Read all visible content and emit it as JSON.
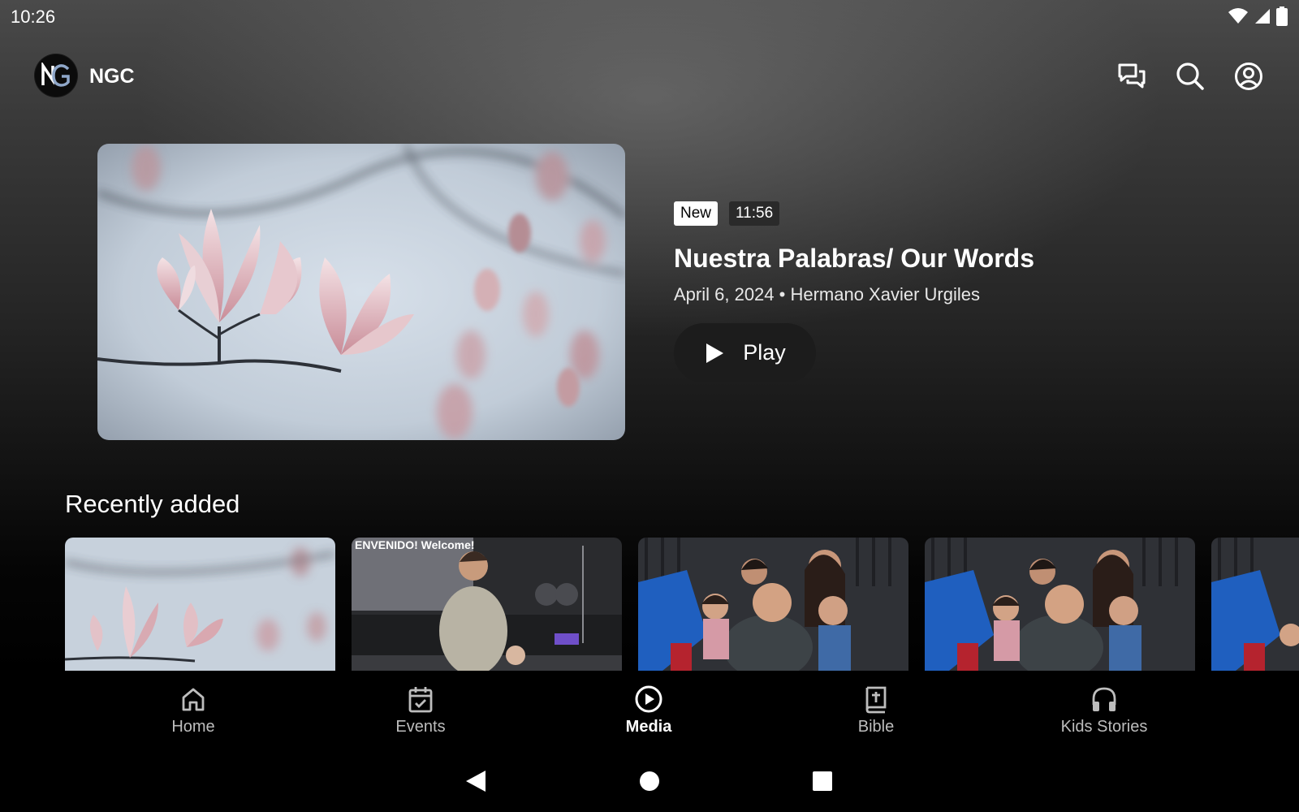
{
  "status_bar": {
    "time": "10:26",
    "icons": [
      "wifi-icon",
      "cell-signal-icon",
      "battery-icon"
    ]
  },
  "app_bar": {
    "logo_text": "NG",
    "app_name": "NGC",
    "actions": [
      "chat-icon",
      "search-icon",
      "account-icon"
    ]
  },
  "hero": {
    "badge_new": "New",
    "duration": "11:56",
    "title": "Nuestra Palabras/ Our Words",
    "subtitle": "April 6, 2024 • Hermano Xavier Urgiles",
    "play_label": "Play"
  },
  "recently_added": {
    "title": "Recently added",
    "thumb_2_text": "ENVENIDO! Welcome!"
  },
  "bottom_nav": {
    "items": [
      {
        "label": "Home",
        "icon": "home-icon"
      },
      {
        "label": "Events",
        "icon": "calendar-icon"
      },
      {
        "label": "Media",
        "icon": "play-circle-icon"
      },
      {
        "label": "Bible",
        "icon": "bible-icon"
      },
      {
        "label": "Kids Stories",
        "icon": "headphones-icon"
      }
    ],
    "active": "Media"
  },
  "colors": {
    "background": "#000000",
    "badge_new_bg": "#ffffff",
    "badge_duration_bg": "#2a2a2a",
    "play_button_bg": "#1c1c1c"
  }
}
